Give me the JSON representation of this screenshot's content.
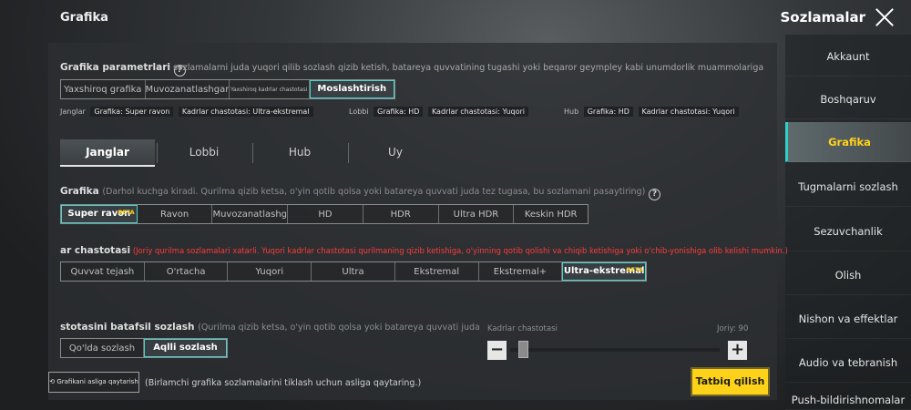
{
  "header": {
    "section_title": "Grafika",
    "settings_title": "Sozlamalar",
    "close_icon": "close-icon"
  },
  "sidebar": {
    "items": [
      {
        "label": "Akkaunt"
      },
      {
        "label": "Boshqaruv"
      },
      {
        "label": "Grafika",
        "active": true
      },
      {
        "label": "Tugmalarni sozlash"
      },
      {
        "label": "Sezuvchanlik"
      },
      {
        "label": "Olish"
      },
      {
        "label": "Nishon va effektlar"
      },
      {
        "label": "Audio va tebranish"
      },
      {
        "label": "Push-bildirishnomalar"
      }
    ]
  },
  "graphics_params": {
    "title": "Grafika parametrlari",
    "help_icon": "help-icon",
    "description": "sozlamalarni juda yuqori qilib sozlash qizib ketish, batareya quvvatining tugashi yoki beqaror geympley kabi unumdorlik muammolariga olib kelishi mumkin",
    "presets": [
      "Yaxshiroq grafika",
      "Muvozanatlashgan",
      "Yaxshiroq kadrlar chastotasi",
      "Moslashtirish"
    ],
    "selected": "Moslashtirish",
    "summary": {
      "janglar": {
        "label": "Janglar",
        "grafika": "Grafika: Super ravon",
        "kadr": "Kadrlar chastotasi: Ultra-ekstremal"
      },
      "lobbi": {
        "label": "Lobbi",
        "grafika": "Grafika: HD",
        "kadr": "Kadrlar chastotasi: Yuqori"
      },
      "hub": {
        "label": "Hub",
        "grafika": "Grafika: HD",
        "kadr": "Kadrlar chastotasi: Yuqori"
      }
    }
  },
  "tabs": [
    "Janglar",
    "Lobbi",
    "Hub",
    "Uy"
  ],
  "active_tab": "Janglar",
  "grafika": {
    "title": "Grafika",
    "note": "(Darhol kuchga kiradi. Qurilma qizib ketsa, o'yin qotib qolsa yoki batareya quvvati juda tez tugasa, bu sozlamani pasaytiring)",
    "options": [
      "Super ravon",
      "Ravon",
      "Muvozanatlashgan",
      "HD",
      "HDR",
      "Ultra HDR",
      "Keskin HDR"
    ],
    "selected": "Super ravon",
    "beta_label": "BETA"
  },
  "frame_rate": {
    "title": "ar chastotasi",
    "warning": "(Joriy qurilma sozlamalari xatarli. Yuqori kadrlar chastotasi qurilmaning qizib ketishiga, o'yinning qotib qolishi va chiqib ketishiga yoki o'chib-yonishiga olib kelishi mumkin.)",
    "options": [
      "Quvvat tejash",
      "O'rtacha",
      "Yuqori",
      "Ultra",
      "Ekstremal",
      "Ekstremal+",
      "Ultra-ekstremal"
    ],
    "selected": "Ultra-ekstremal",
    "beta_label": "BETA"
  },
  "detailed": {
    "title": "stotasini batafsil sozlash",
    "note": "(Qurilma qizib ketsa, o'yin qotib qolsa yoki batareya quvvati juda tez tugasa, bu so",
    "modes": [
      "Qo'lda sozlash",
      "Aqlli sozlash"
    ],
    "selected": "Aqlli sozlash",
    "slider_label": "Kadrlar chastotasi",
    "current": "Joriy: 90",
    "minus_icon": "minus-icon",
    "plus_icon": "plus-icon",
    "slider_fraction": 0.04
  },
  "footer": {
    "reset_label": "Grafikani asliga qaytarish",
    "reset_note": "(Birlamchi grafika sozlamalarini tiklash uchun asliga qaytaring.)",
    "apply_label": "Tatbiq qilish"
  },
  "colors": {
    "accent": "#4ad2cc",
    "apply": "#ffd21a",
    "warning": "#ff3b3b"
  }
}
